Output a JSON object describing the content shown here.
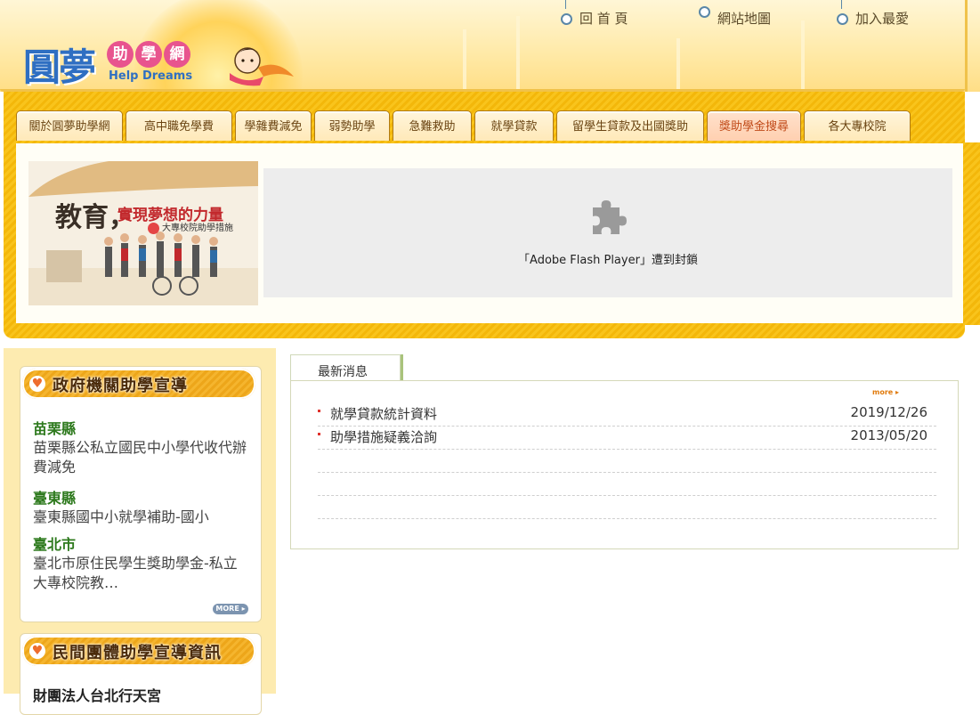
{
  "header": {
    "logo_text": "圓夢",
    "logo_badges": [
      "助",
      "學",
      "網"
    ],
    "logo_english": "Help Dreams",
    "links": [
      {
        "label": "回 首 頁"
      },
      {
        "label": "網站地圖"
      },
      {
        "label": "加入最愛"
      }
    ]
  },
  "nav": {
    "tabs": [
      {
        "label": "關於圓夢助學網",
        "active": false
      },
      {
        "label": "高中職免學費",
        "active": false
      },
      {
        "label": "學雜費減免",
        "active": false
      },
      {
        "label": "弱勢助學",
        "active": false
      },
      {
        "label": "急難救助",
        "active": false
      },
      {
        "label": "就學貸款",
        "active": false
      },
      {
        "label": "留學生貸款及出國獎助",
        "active": false
      },
      {
        "label": "獎助學金搜尋",
        "active": true
      },
      {
        "label": "各大專校院",
        "active": false
      }
    ]
  },
  "banner": {
    "title": "教育，",
    "subtitle": "實現夢想的力量",
    "caption": "大專校院助學措施"
  },
  "flash": {
    "message": "「Adobe Flash Player」遭到封鎖",
    "icon": "puzzle-piece-icon"
  },
  "gov_panel": {
    "title": "政府機關助學宣導",
    "items": [
      {
        "region": "苗栗縣",
        "text": "苗栗縣公私立國民中小學代收代辦費減免"
      },
      {
        "region": "臺東縣",
        "text": "臺東縣國中小就學補助-國小"
      },
      {
        "region": "臺北市",
        "text": "臺北市原住民學生獎助學金-私立大專校院教…"
      }
    ],
    "more_label": "MORE ▸"
  },
  "civil_panel": {
    "title": "民間團體助學宣導資訊",
    "first_item": "財團法人台北行天宮"
  },
  "news": {
    "tab_label": "最新消息",
    "more_label": "more ▸",
    "items": [
      {
        "title": "就學貸款統計資料",
        "date": "2019/12/26"
      },
      {
        "title": "助學措施疑義洽詢",
        "date": "2013/05/20"
      },
      {
        "title": "",
        "date": ""
      },
      {
        "title": "",
        "date": ""
      },
      {
        "title": "",
        "date": ""
      }
    ]
  },
  "colors": {
    "accent_yellow": "#f9c41c",
    "logo_blue": "#2f6fc2",
    "active_tab_text": "#c14b1a",
    "region_green": "#2e7a1e"
  }
}
